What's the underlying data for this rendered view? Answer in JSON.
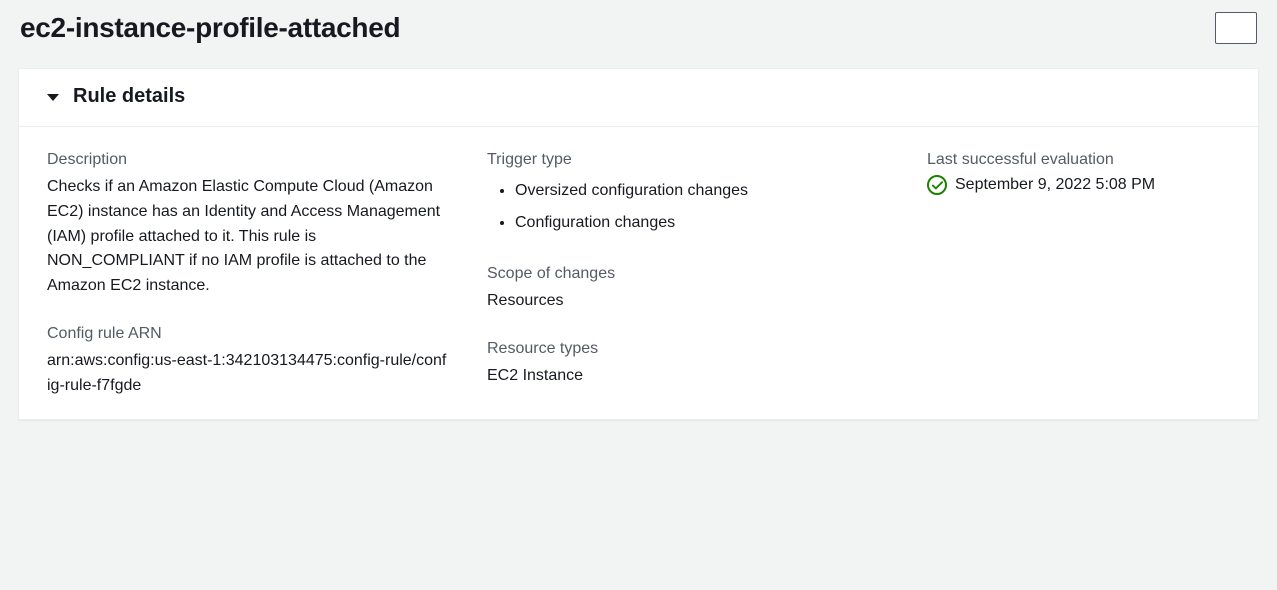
{
  "header": {
    "title": "ec2-instance-profile-attached"
  },
  "card": {
    "title": "Rule details"
  },
  "description": {
    "label": "Description",
    "value": "Checks if an Amazon Elastic Compute Cloud (Amazon EC2) instance has an Identity and Access Management (IAM) profile attached to it. This rule is NON_COMPLIANT if no IAM profile is attached to the Amazon EC2 instance."
  },
  "arn": {
    "label": "Config rule ARN",
    "value": "arn:aws:config:us-east-1:342103134475:config-rule/config-rule-f7fgde"
  },
  "trigger": {
    "label": "Trigger type",
    "items": [
      "Oversized configuration changes",
      "Configuration changes"
    ]
  },
  "scope": {
    "label": "Scope of changes",
    "value": "Resources"
  },
  "resource_types": {
    "label": "Resource types",
    "value": "EC2 Instance"
  },
  "evaluation": {
    "label": "Last successful evaluation",
    "value": "September 9, 2022 5:08 PM"
  }
}
